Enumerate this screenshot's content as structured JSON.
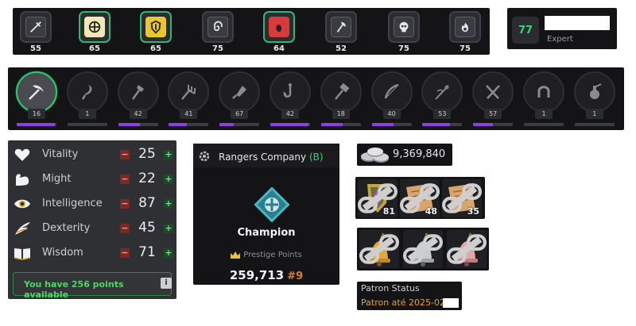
{
  "combat": {
    "skills": [
      {
        "icon": "dagger-icon",
        "level": "55",
        "highlight": false,
        "tone": "grey"
      },
      {
        "icon": "target-icon",
        "level": "65",
        "highlight": true,
        "tone": "gold"
      },
      {
        "icon": "shield-icon",
        "level": "65",
        "highlight": true,
        "tone": "yellow"
      },
      {
        "icon": "spiral-icon",
        "level": "75",
        "highlight": false,
        "tone": "grey"
      },
      {
        "icon": "flame-icon",
        "level": "64",
        "highlight": true,
        "tone": "red"
      },
      {
        "icon": "axe-icon",
        "level": "52",
        "highlight": false,
        "tone": "grey"
      },
      {
        "icon": "skull-icon",
        "level": "75",
        "highlight": false,
        "tone": "grey"
      },
      {
        "icon": "fire-icon",
        "level": "75",
        "highlight": false,
        "tone": "grey"
      }
    ]
  },
  "total": {
    "level": "77",
    "tier": "Expert"
  },
  "gathering": {
    "skills": [
      {
        "icon": "pickaxe-icon",
        "level": "16",
        "progress": 0.95,
        "active": true
      },
      {
        "icon": "sickle-icon",
        "level": "1",
        "progress": 0.0,
        "active": false
      },
      {
        "icon": "hatchet-icon",
        "level": "42",
        "progress": 0.55,
        "active": false
      },
      {
        "icon": "pitchfork-icon",
        "level": "41",
        "progress": 0.45,
        "active": false
      },
      {
        "icon": "cleaver-icon",
        "level": "67",
        "progress": 0.35,
        "active": false
      },
      {
        "icon": "fishing-hook-icon",
        "level": "42",
        "progress": 0.95,
        "active": false
      },
      {
        "icon": "hammer-icon",
        "level": "18",
        "progress": 0.55,
        "active": false
      },
      {
        "icon": "bow-icon",
        "level": "40",
        "progress": 0.55,
        "active": false
      },
      {
        "icon": "needle-icon",
        "level": "53",
        "progress": 0.7,
        "active": false
      },
      {
        "icon": "fork-knife-icon",
        "level": "57",
        "progress": 0.5,
        "active": false
      },
      {
        "icon": "horseshoe-icon",
        "level": "1",
        "progress": 0.0,
        "active": false
      },
      {
        "icon": "potion-icon",
        "level": "1",
        "progress": 0.0,
        "active": false
      }
    ]
  },
  "attributes": {
    "rows": [
      {
        "name": "Vitality",
        "value": "25",
        "icon": "heart-icon"
      },
      {
        "name": "Might",
        "value": "22",
        "icon": "flexed-arm-icon"
      },
      {
        "name": "Intelligence",
        "value": "87",
        "icon": "eye-icon"
      },
      {
        "name": "Dexterity",
        "value": "45",
        "icon": "wing-icon"
      },
      {
        "name": "Wisdom",
        "value": "71",
        "icon": "book-icon"
      }
    ],
    "minus": "−",
    "plus": "+",
    "available": "You have 256 points available",
    "info": "i"
  },
  "guild": {
    "name": "Rangers Company",
    "rank_badge": "(B)",
    "title": "Champion",
    "points_label": "Prestige Points",
    "points": "259,713",
    "rank": "#9"
  },
  "coins": {
    "value": "9,369,840"
  },
  "items": {
    "row1": [
      {
        "name": "amethyst-shield",
        "qty": "81"
      },
      {
        "name": "scroll",
        "qty": "48"
      },
      {
        "name": "scroll",
        "qty": "35"
      }
    ],
    "row2": [
      {
        "name": "gold-bell",
        "qty": ""
      },
      {
        "name": "silver-bell",
        "qty": ""
      },
      {
        "name": "rose-bell",
        "qty": ""
      }
    ]
  },
  "patron": {
    "label": "Patron Status",
    "date": "Patron até 2025-02"
  },
  "colors": {
    "accent_green": "#2ecc71",
    "progress_purple": "#8e3fe3",
    "rank_orange": "#e0802b",
    "patron_gold": "#f0a020"
  }
}
